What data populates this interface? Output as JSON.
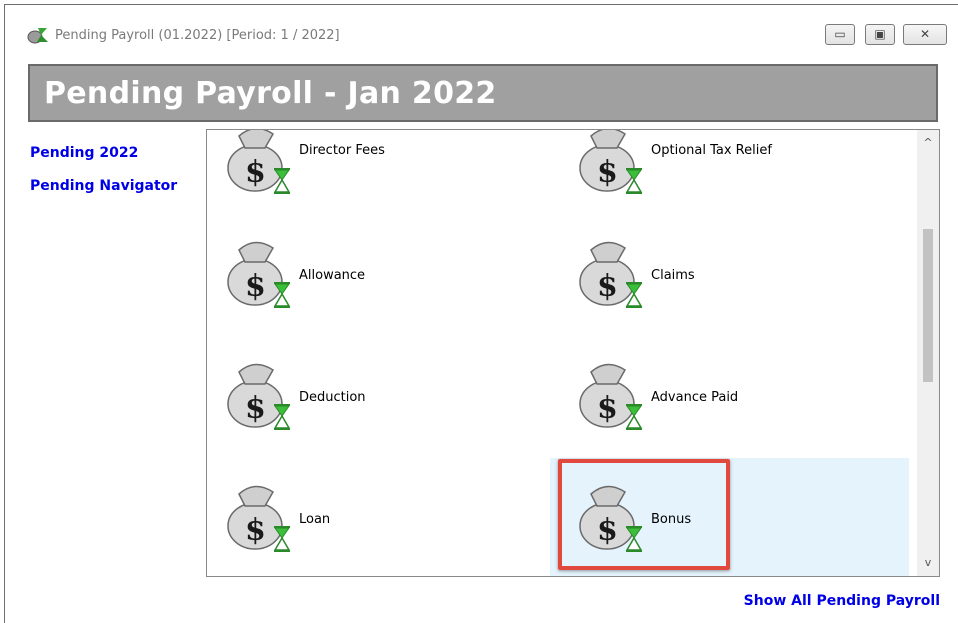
{
  "window": {
    "title": "Pending Payroll (01.2022) [Period: 1 / 2022]",
    "controls": {
      "minimize": "▭",
      "maximize": "▣",
      "close": "✕"
    }
  },
  "header": {
    "title": "Pending Payroll - Jan 2022"
  },
  "sidebar": {
    "items": [
      {
        "label": "Pending 2022"
      },
      {
        "label": "Pending Navigator"
      }
    ]
  },
  "grid": {
    "items": [
      {
        "label": "Director Fees",
        "icon": "money-bag-hourglass-icon"
      },
      {
        "label": "Optional Tax Relief",
        "icon": "money-bag-hourglass-icon"
      },
      {
        "label": "Allowance",
        "icon": "money-bag-hourglass-icon"
      },
      {
        "label": "Claims",
        "icon": "money-bag-hourglass-icon"
      },
      {
        "label": "Deduction",
        "icon": "money-bag-hourglass-icon"
      },
      {
        "label": "Advance Paid",
        "icon": "money-bag-hourglass-icon"
      },
      {
        "label": "Loan",
        "icon": "money-bag-hourglass-icon"
      },
      {
        "label": "Bonus",
        "icon": "money-bag-hourglass-icon",
        "selected": true
      }
    ]
  },
  "scrollbar": {
    "up": "^",
    "down": "v"
  },
  "footer": {
    "link": "Show All Pending Payroll"
  },
  "colors": {
    "link": "#0000e6",
    "header_bg": "#a0a0a0",
    "selection_bg": "#e5f3fd",
    "highlight_border": "#e2493e"
  }
}
